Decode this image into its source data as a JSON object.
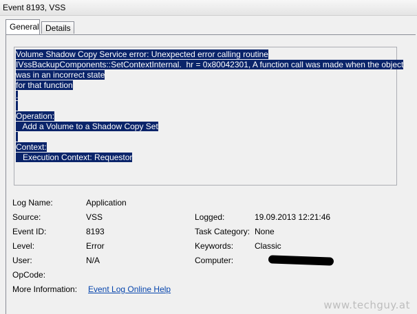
{
  "window": {
    "title": "Event 8193, VSS"
  },
  "tabs": [
    {
      "label": "General",
      "active": true
    },
    {
      "label": "Details",
      "active": false
    }
  ],
  "description": {
    "lines": [
      "Volume Shadow Copy Service error: Unexpected error calling routine",
      "IVssBackupComponents::SetContextInternal.  hr = 0x80042301, A function call was made when the object",
      "was in an incorrect state",
      "for that function",
      ".",
      " ",
      "Operation:",
      "   Add a Volume to a Shadow Copy Set",
      " ",
      "Context:",
      "   Execution Context: Requestor"
    ]
  },
  "fields": {
    "log_name": {
      "label": "Log Name:",
      "value": "Application"
    },
    "source": {
      "label": "Source:",
      "value": "VSS"
    },
    "event_id": {
      "label": "Event ID:",
      "value": "8193"
    },
    "level": {
      "label": "Level:",
      "value": "Error"
    },
    "user": {
      "label": "User:",
      "value": "N/A"
    },
    "opcode": {
      "label": "OpCode:",
      "value": ""
    },
    "more_info": {
      "label": "More Information:",
      "value": "Event Log Online Help"
    },
    "logged": {
      "label": "Logged:",
      "value": "19.09.2013 12:21:46"
    },
    "task_category": {
      "label": "Task Category:",
      "value": "None"
    },
    "keywords": {
      "label": "Keywords:",
      "value": "Classic"
    },
    "computer": {
      "label": "Computer:",
      "value": ""
    }
  },
  "watermark": "www.techguy.at",
  "colors": {
    "selection": "#0a246a",
    "link": "#0645ad"
  }
}
